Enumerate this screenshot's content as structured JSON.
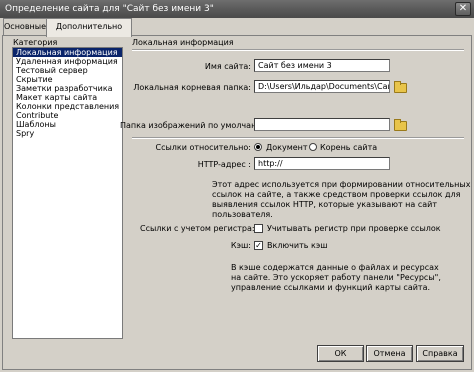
{
  "window": {
    "title": "Определение сайта для \"Сайт без имени 3\""
  },
  "tabs": [
    {
      "label": "Основные"
    },
    {
      "label": "Дополнительно"
    }
  ],
  "category": {
    "heading": "Категория",
    "items": [
      "Локальная информация",
      "Удаленная информация",
      "Тестовый сервер",
      "Скрытие",
      "Заметки разработчика",
      "Макет карты сайта",
      "Колонки представления файлов",
      "Contribute",
      "Шаблоны",
      "Spry"
    ],
    "selected_index": 0
  },
  "section": {
    "title": "Локальная информация"
  },
  "form": {
    "site_name_label": "Имя сайта:",
    "site_name_value": "Сайт без имени 3",
    "local_root_label": "Локальная корневая папка:",
    "local_root_value": "D:\\Users\\Ильдар\\Documents\\Сайт без и",
    "images_folder_label": "Папка изображений по умолчанию:",
    "images_folder_value": "",
    "links_relative_label": "Ссылки относительно:",
    "links_option_document": "Документ",
    "links_option_site_root": "Корень сайта",
    "links_selected": "Документ",
    "http_label": "HTTP-адрес :",
    "http_value": "http://",
    "http_note_lines": [
      "Этот адрес используется при формировании относительных",
      "ссылок на сайте, а также средством проверки ссылок для",
      "выявления ссылок HTTP, которые указывают на сайт",
      "пользователя."
    ],
    "case_links_label": "Ссылки с учетом регистра:",
    "case_links_option": "Учитывать регистр при проверке ссылок",
    "case_links_checked": false,
    "cache_label": "Кэш:",
    "cache_option": "Включить кэш",
    "cache_checked": true,
    "cache_note_lines": [
      "В кэше содержатся данные о файлах и ресурсах",
      "на сайте. Это ускоряет работу панели \"Ресурсы\",",
      "управление ссылками и функций карты сайта."
    ]
  },
  "buttons": {
    "ok": "ОК",
    "cancel": "Отмена",
    "help": "Справка"
  },
  "colors": {
    "selection": "#0a246a",
    "dialog_bg": "#d4d0c8",
    "titlebar": "#5a5a5a"
  }
}
